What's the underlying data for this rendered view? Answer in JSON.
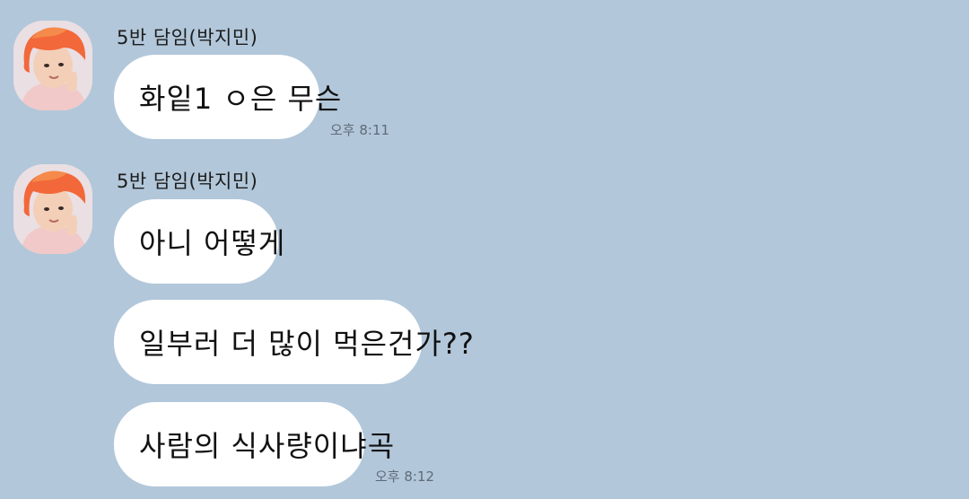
{
  "theme": {
    "background": "#b2c7da",
    "bubble": "#ffffff",
    "hair": "#f2683a",
    "skin": "#f3cfb8"
  },
  "messages": [
    {
      "sender": "5반 담임(박지민)",
      "avatar_icon": "profile-photo",
      "bubbles": [
        "화잍1 ㅇ은 무슨"
      ],
      "time": "오후 8:11"
    },
    {
      "sender": "5반 담임(박지민)",
      "avatar_icon": "profile-photo",
      "bubbles": [
        "아니 어떻게",
        "일부러 더 많이 먹은건가??",
        "사람의 식사량이냐곡"
      ],
      "time": "오후 8:12"
    }
  ]
}
